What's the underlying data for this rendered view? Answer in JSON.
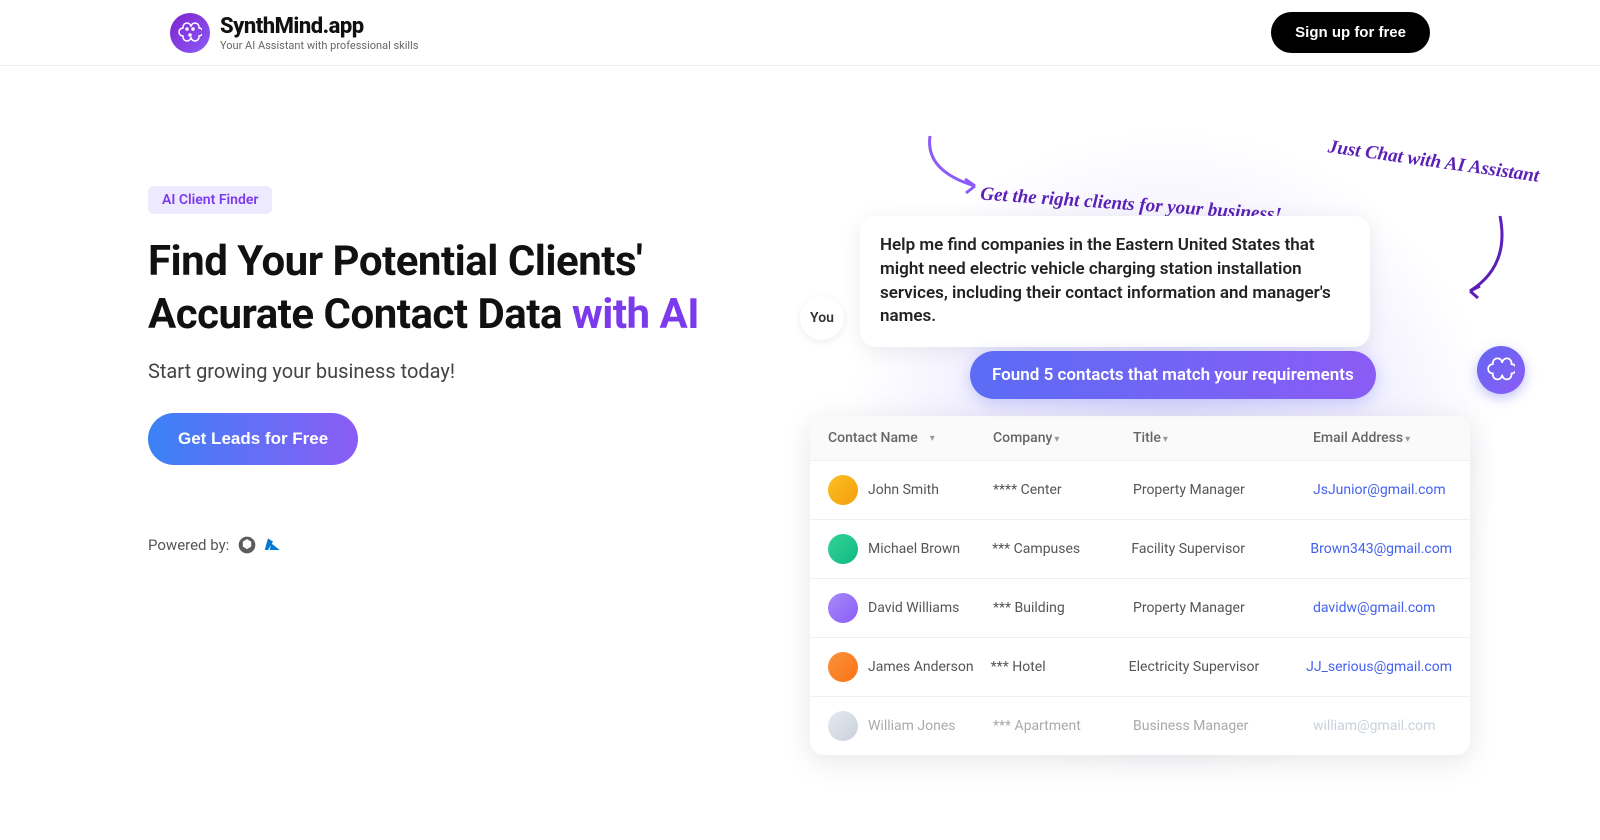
{
  "header": {
    "logo_title": "SynthMind.app",
    "logo_sub": "Your AI Assistant with professional skills",
    "signup": "Sign up for free"
  },
  "hero": {
    "badge": "AI Client Finder",
    "headline_main": "Find Your Potential Clients' Accurate Contact Data ",
    "headline_accent": "with AI",
    "subhead": "Start growing your business today!",
    "cta": "Get Leads for Free",
    "powered_label": "Powered by:"
  },
  "chat": {
    "you_label": "You",
    "user_msg": "Help me find companies in the Eastern United States that might need electric vehicle charging station installation services, including their contact information and manager's names.",
    "result": "Found 5 contacts that match your requirements"
  },
  "notes": {
    "top": "Just Chat with AI Assistant",
    "bottom": "Get the right clients for your business!"
  },
  "table": {
    "headers": {
      "name": "Contact Name",
      "company": "Company",
      "title": "Title",
      "email": "Email Address"
    },
    "rows": [
      {
        "name": "John Smith",
        "company": "**** Center",
        "title": "Property Manager",
        "email": "JsJunior@gmail.com"
      },
      {
        "name": "Michael Brown",
        "company": "*** Campuses",
        "title": "Facility Supervisor",
        "email": "Brown343@gmail.com"
      },
      {
        "name": "David Williams",
        "company": "*** Building",
        "title": "Property Manager",
        "email": "davidw@gmail.com"
      },
      {
        "name": "James Anderson",
        "company": "*** Hotel",
        "title": "Electricity Supervisor",
        "email": "JJ_serious@gmail.com"
      },
      {
        "name": "William Jones",
        "company": "*** Apartment",
        "title": "Business Manager",
        "email": "william@gmail.com"
      }
    ]
  }
}
